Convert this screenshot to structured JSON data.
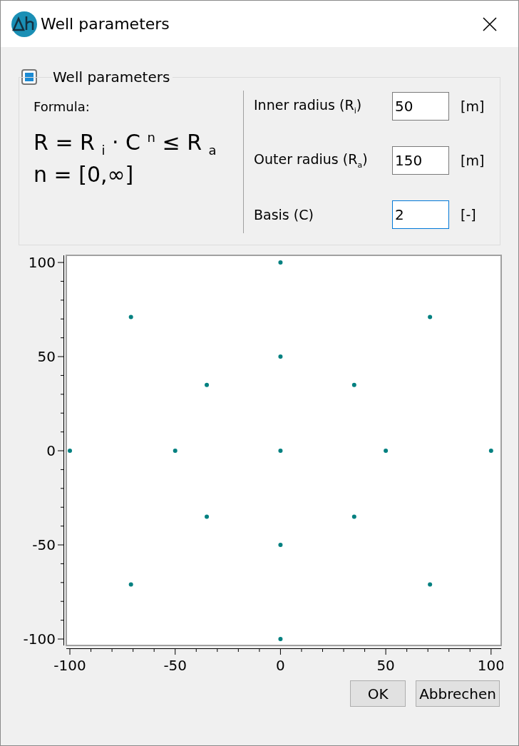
{
  "window": {
    "title": "Well parameters"
  },
  "group": {
    "title": "Well parameters",
    "checked": true
  },
  "formula": {
    "label": "Formula:",
    "lines": [
      "R = R $_{i}$ · C $^{n}$ ≤ R $_{a}$",
      "n = [0,∞]"
    ]
  },
  "fields": [
    {
      "label": "Inner radius (R$_{i}$)",
      "value": "50",
      "unit": "[m]",
      "focused": false
    },
    {
      "label": "Outer radius (R$_{a}$)",
      "value": "150",
      "unit": "[m]",
      "focused": false
    },
    {
      "label": "Basis (C)",
      "value": "2",
      "unit": "[-]",
      "focused": true
    }
  ],
  "plot": {
    "chart_data": {
      "type": "scatter",
      "xlim": [
        -101.7,
        104.8
      ],
      "ylim": [
        -103.4,
        103.8
      ],
      "xticks": [
        -100,
        -50,
        0,
        50,
        100
      ],
      "yticks": [
        -100,
        -50,
        0,
        50,
        100
      ],
      "x": [
        0,
        0,
        0,
        0,
        0,
        50,
        -50,
        100,
        -100,
        35,
        -35,
        35,
        -35,
        71,
        -71,
        71,
        -71
      ],
      "series": [
        {
          "color": "#008080",
          "values": [
            0,
            50,
            -50,
            100,
            -100,
            0,
            0,
            0,
            0,
            35,
            35,
            -35,
            -35,
            71,
            71,
            -71,
            -71
          ]
        }
      ]
    }
  },
  "buttons": [
    "OK",
    "Abbrechen"
  ]
}
